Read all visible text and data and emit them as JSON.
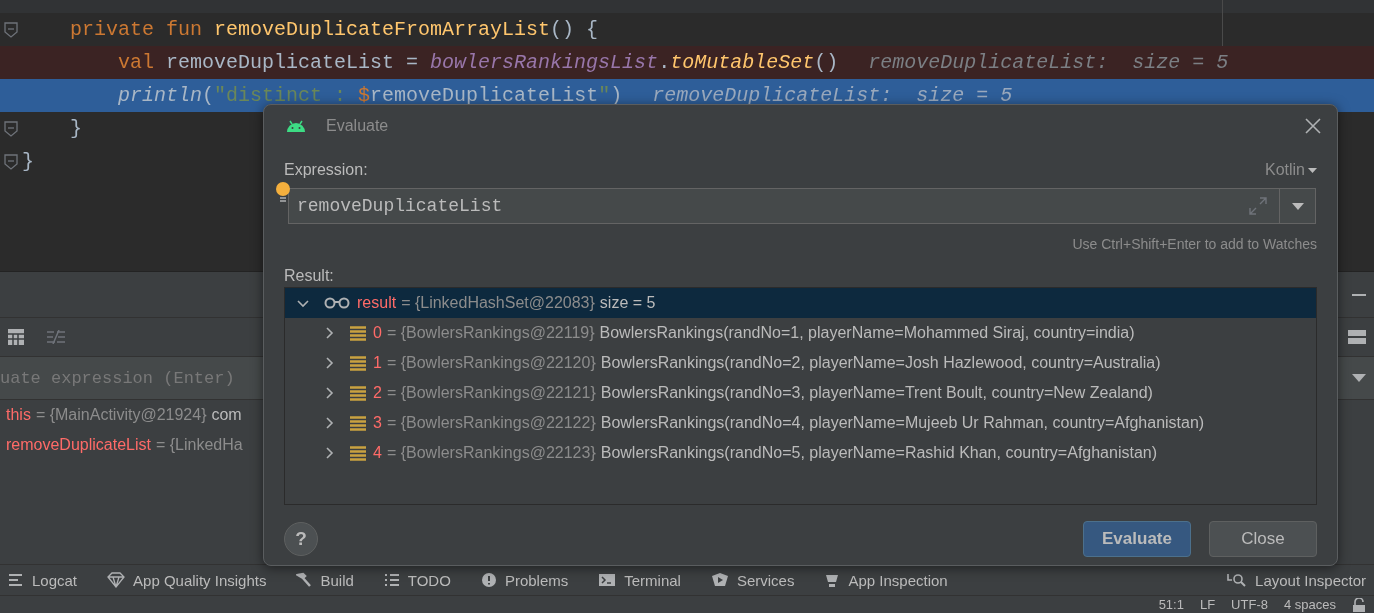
{
  "editor": {
    "lines": [
      {
        "kind": "plain",
        "fold": true,
        "tokens": [
          {
            "kind": "keyword",
            "text": "    private fun "
          },
          {
            "kind": "function",
            "text": "removeDuplicateFromArrayList"
          },
          {
            "kind": "plain",
            "text": "() {"
          }
        ]
      },
      {
        "kind": "breakpoint",
        "fold": false,
        "tokens": [
          {
            "kind": "keyword",
            "text": "        val "
          },
          {
            "kind": "plain",
            "text": "removeDuplicateList = "
          },
          {
            "kind": "field",
            "text": "bowlersRankingsList"
          },
          {
            "kind": "plain",
            "text": "."
          },
          {
            "kind": "call",
            "text": "toMutableSet"
          },
          {
            "kind": "plain",
            "text": "()"
          }
        ],
        "hint": "removeDuplicateList:  size = 5"
      },
      {
        "kind": "current",
        "fold": false,
        "tokens": [
          {
            "kind": "static",
            "text": "        println"
          },
          {
            "kind": "plain",
            "text": "("
          },
          {
            "kind": "string",
            "text": "\"distinct : "
          },
          {
            "kind": "keyword",
            "text": "$"
          },
          {
            "kind": "plain",
            "text": "removeDuplicateList"
          },
          {
            "kind": "string",
            "text": "\""
          },
          {
            "kind": "plain",
            "text": ")"
          }
        ],
        "hint": "removeDuplicateList:  size = 5"
      },
      {
        "kind": "plain",
        "fold": true,
        "tokens": [
          {
            "kind": "plain",
            "text": "    }"
          }
        ]
      },
      {
        "kind": "plain",
        "fold": true,
        "tokens": [
          {
            "kind": "plain",
            "text": "}"
          }
        ]
      }
    ]
  },
  "debug_panel": {
    "expression_placeholder": "uate expression (Enter)",
    "variables": [
      {
        "name": "this",
        "ref": "= {MainActivity@21924}",
        "value": "com"
      },
      {
        "name": "removeDuplicateList",
        "ref": "= {LinkedHa"
      }
    ]
  },
  "dialog": {
    "title": "Evaluate",
    "expression_label": "Expression:",
    "language": "Kotlin",
    "expression": {
      "value": "removeDuplicateList"
    },
    "hint": "Use Ctrl+Shift+Enter to add to Watches",
    "result_label": "Result:",
    "result_tree": [
      {
        "kind": "watch",
        "name": "result",
        "ref": "= {LinkedHashSet@22083}",
        "value": "size = 5",
        "expanded": true,
        "selected": true,
        "children": [
          {
            "kind": "item",
            "name": "0",
            "ref": "= {BowlersRankings@22119}",
            "value": "BowlersRankings(randNo=1, playerName=Mohammed Siraj, country=india)",
            "expanded": false,
            "selected": false
          },
          {
            "kind": "item",
            "name": "1",
            "ref": "= {BowlersRankings@22120}",
            "value": "BowlersRankings(randNo=2, playerName=Josh Hazlewood, country=Australia)",
            "expanded": false,
            "selected": false
          },
          {
            "kind": "item",
            "name": "2",
            "ref": "= {BowlersRankings@22121}",
            "value": "BowlersRankings(randNo=3, playerName=Trent Boult, country=New Zealand)",
            "expanded": false,
            "selected": false
          },
          {
            "kind": "item",
            "name": "3",
            "ref": "= {BowlersRankings@22122}",
            "value": "BowlersRankings(randNo=4, playerName=Mujeeb Ur Rahman, country=Afghanistan)",
            "expanded": false,
            "selected": false
          },
          {
            "kind": "item",
            "name": "4",
            "ref": "= {BowlersRankings@22123}",
            "value": "BowlersRankings(randNo=5, playerName=Rashid Khan, country=Afghanistan)",
            "expanded": false,
            "selected": false
          }
        ]
      }
    ],
    "help": "?",
    "buttons": [
      {
        "label": "Evaluate",
        "kind": "default"
      },
      {
        "label": "Close",
        "kind": "normal"
      }
    ]
  },
  "tool_windows": [
    {
      "label": "Logcat",
      "kind": "lines"
    },
    {
      "label": "App Quality Insights",
      "kind": "diamond"
    },
    {
      "label": "Build",
      "kind": "hammer"
    },
    {
      "label": "TODO",
      "kind": "list"
    },
    {
      "label": "Problems",
      "kind": "alert"
    },
    {
      "label": "Terminal",
      "kind": "terminal"
    },
    {
      "label": "Services",
      "kind": "services"
    },
    {
      "label": "App Inspection",
      "kind": "inspection"
    }
  ],
  "tool_windows_right": [
    {
      "label": "Layout Inspector",
      "kind": "layout"
    }
  ],
  "status_bar": [
    "51:1",
    "LF",
    "UTF-8",
    "4 spaces"
  ]
}
